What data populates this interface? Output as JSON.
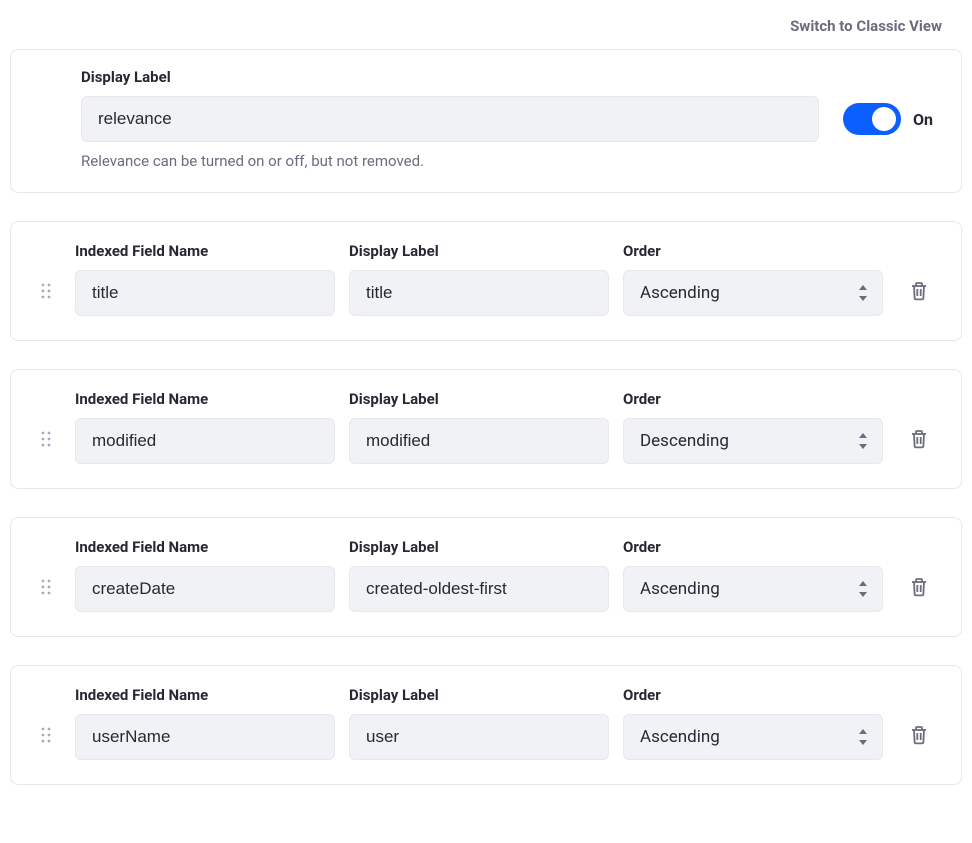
{
  "topLink": "Switch to Classic View",
  "relevance": {
    "labelTitle": "Display Label",
    "value": "relevance",
    "helper": "Relevance can be turned on or off, but not removed.",
    "toggleState": "On"
  },
  "columnHeaders": {
    "indexed": "Indexed Field Name",
    "display": "Display Label",
    "order": "Order"
  },
  "rows": [
    {
      "indexed": "title",
      "display": "title",
      "order": "Ascending"
    },
    {
      "indexed": "modified",
      "display": "modified",
      "order": "Descending"
    },
    {
      "indexed": "createDate",
      "display": "created-oldest-first",
      "order": "Ascending"
    },
    {
      "indexed": "userName",
      "display": "user",
      "order": "Ascending"
    }
  ]
}
